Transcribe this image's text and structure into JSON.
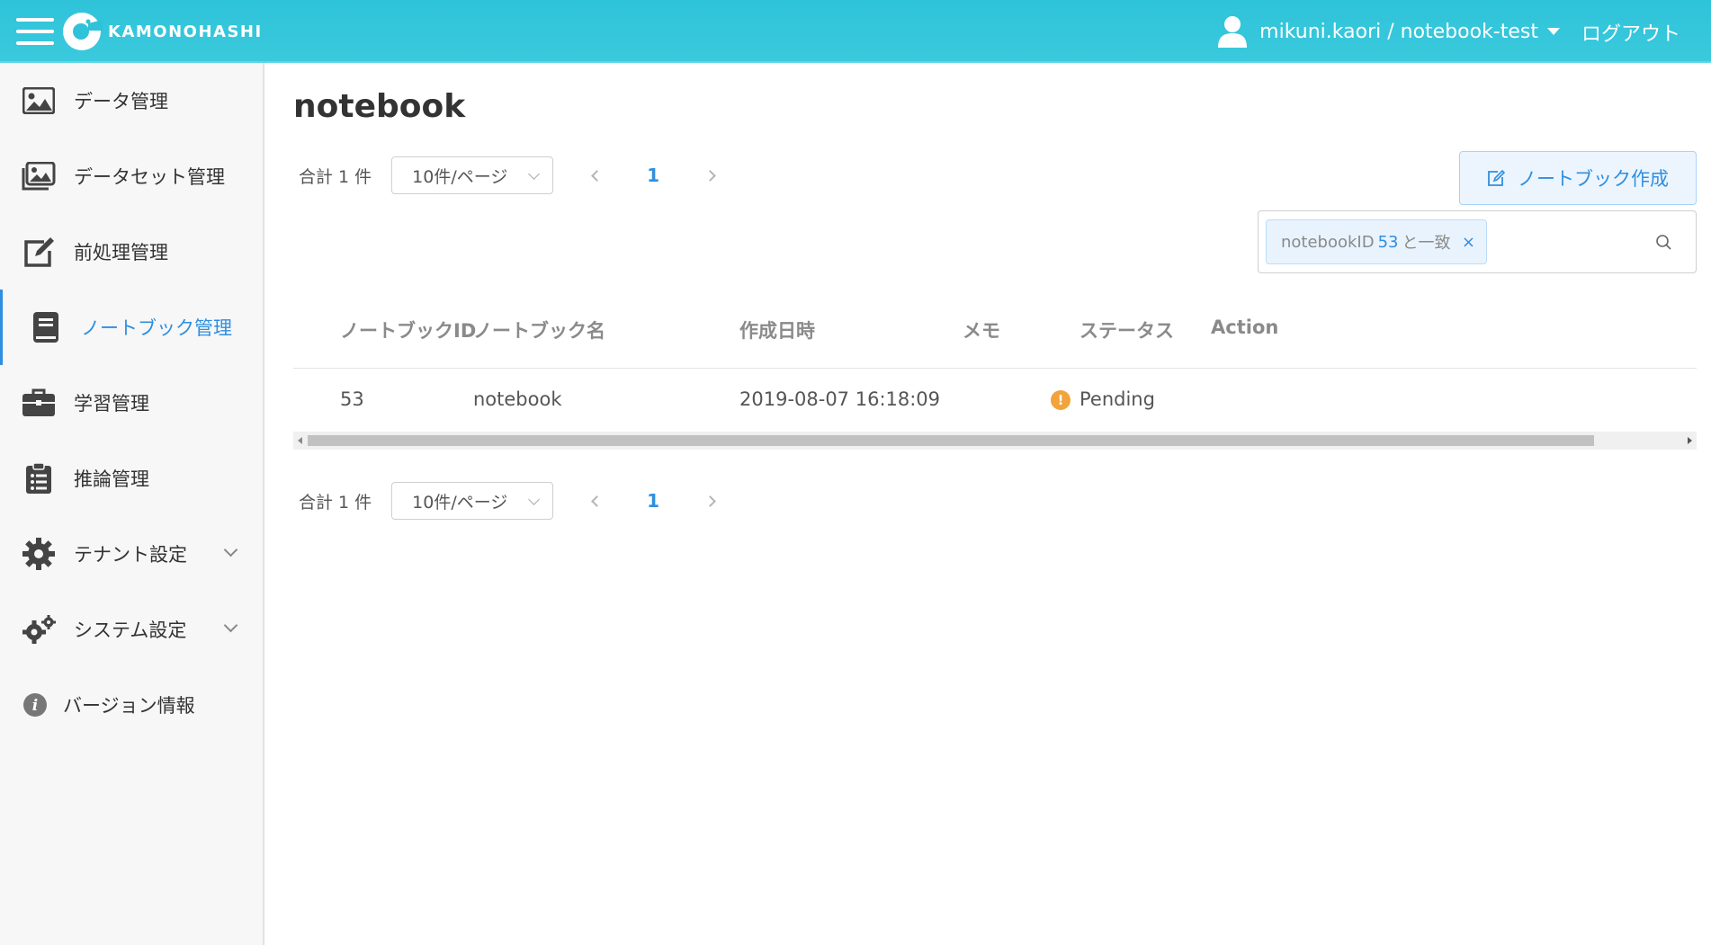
{
  "header": {
    "logo_text": "KAMONOHASHI",
    "user_label": "mikuni.kaori / notebook-test",
    "logout_label": "ログアウト"
  },
  "sidebar": {
    "items": [
      {
        "label": "データ管理",
        "icon": "image-icon"
      },
      {
        "label": "データセット管理",
        "icon": "images-icon"
      },
      {
        "label": "前処理管理",
        "icon": "edit-icon"
      },
      {
        "label": "ノートブック管理",
        "icon": "book-icon",
        "active": true
      },
      {
        "label": "学習管理",
        "icon": "briefcase-icon"
      },
      {
        "label": "推論管理",
        "icon": "clipboard-icon"
      },
      {
        "label": "テナント設定",
        "icon": "gear-icon",
        "expandable": true
      },
      {
        "label": "システム設定",
        "icon": "gears-icon",
        "expandable": true
      },
      {
        "label": "バージョン情報",
        "icon": "info-icon"
      }
    ]
  },
  "main": {
    "title": "notebook",
    "pagination": {
      "total_label": "合計 1 件",
      "page_size": "10件/ページ",
      "current_page": "1"
    },
    "create_button_label": "ノートブック作成",
    "filter": {
      "tag_prefix": "notebookID",
      "tag_value": "53",
      "tag_suffix": "と一致",
      "close_glyph": "×"
    },
    "table": {
      "columns": [
        "ノートブックID",
        "ノートブック名",
        "作成日時",
        "メモ",
        "ステータス",
        "Action"
      ],
      "rows": [
        {
          "id": "53",
          "name": "notebook",
          "created": "2019-08-07 16:18:09",
          "memo": "",
          "status": "Pending",
          "action": ""
        }
      ]
    },
    "colors": {
      "header_bg": "#2fc3d9",
      "accent": "#2f8fe0",
      "status_pending": "#f2a33a"
    }
  }
}
